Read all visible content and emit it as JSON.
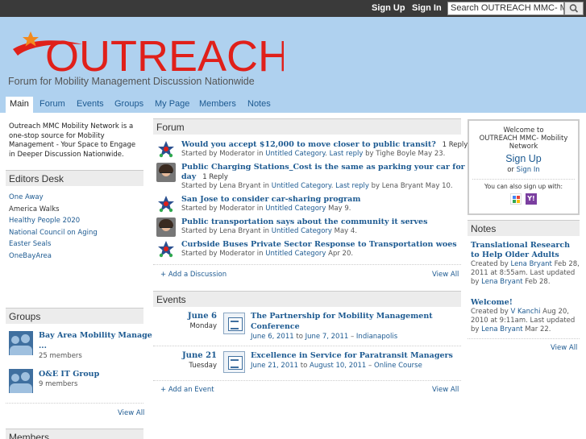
{
  "topbar": {
    "signup": "Sign Up",
    "signin": "Sign In",
    "search_value": "Search OUTREACH MMC- Mobi"
  },
  "header": {
    "logo_text": "OUTREACH",
    "tagline": "Forum for Mobility Management Discussion Nationwide",
    "brand_color": "#e0201a"
  },
  "nav": [
    "Main",
    "Forum",
    "Events",
    "Groups",
    "My Page",
    "Members",
    "Notes"
  ],
  "left": {
    "intro": "Outreach MMC Mobility Network is a one-stop source for Mobility Management - Your Space to Engage in Deeper Discussion Nationwide.",
    "editors_title": "Editors Desk",
    "editors_links": [
      "One Away",
      "America Walks",
      "Healthy People 2020",
      "National Council on Aging",
      "Easter Seals",
      "OneBayArea"
    ],
    "groups_title": "Groups",
    "groups": [
      {
        "name": "Bay Area Mobility Manage",
        "ellipsis": "...",
        "members": "25 members"
      },
      {
        "name": "O&E IT Group",
        "members": "9 members"
      }
    ],
    "groups_view_all": "View All",
    "members_title": "Members"
  },
  "forum": {
    "title": "Forum",
    "items": [
      {
        "title": "Would you accept $12,000 to move closer to public transit?",
        "reply": "1 Reply",
        "started_by": "Started by Moderator in",
        "category": "Untitled Category",
        "last_reply_label": "Last reply",
        "last_reply_by": "by Tighe Boyle May 23."
      },
      {
        "title": "Public Charging Stations_Cost is the same as parking your car for the",
        "title2": "day",
        "reply": "1 Reply",
        "started_by": "Started by Lena Bryant in",
        "category": "Untitled Category",
        "last_reply_label": "Last reply",
        "last_reply_by": "by Lena Bryant May 10."
      },
      {
        "title": "San Jose to consider car-sharing program",
        "started_by": "Started by Moderator in",
        "category": "Untitled Category",
        "date": "May 9."
      },
      {
        "title": "Public transportation says about the community it serves",
        "started_by": "Started by Lena Bryant in",
        "category": "Untitled Category",
        "date": "May 4."
      },
      {
        "title": "Curbside Buses Private Sector Response to Transportation woes",
        "started_by": "Started by Moderator in",
        "category": "Untitled Category",
        "date": "Apr 20."
      }
    ],
    "add": "+ Add a Discussion",
    "view_all": "View All"
  },
  "events": {
    "title": "Events",
    "items": [
      {
        "date": "June 6",
        "weekday": "Monday",
        "title": "The Partnership for Mobility Management",
        "title2": "Conference",
        "start": "June 6, 2011",
        "to": "to",
        "end": "June 7, 2011",
        "sep": "–",
        "location": "Indianapolis"
      },
      {
        "date": "June 21",
        "weekday": "Tuesday",
        "title": "Excellence in Service for Paratransit Managers",
        "start": "June 21, 2011",
        "to": "to",
        "end": "August 10, 2011",
        "sep": "–",
        "location": "Online Course"
      }
    ],
    "add": "+ Add an Event",
    "view_all": "View All"
  },
  "welcome": {
    "line1": "Welcome to",
    "line2": "OUTREACH MMC- Mobility",
    "line3": "Network",
    "signup": "Sign Up",
    "or": "or",
    "signin": "Sign In",
    "also": "You can also sign up with:"
  },
  "notes": {
    "title": "Notes",
    "items": [
      {
        "title": "Translational Research to Help Older Adults",
        "meta1": "Created by",
        "author": "Lena Bryant",
        "meta2": "Feb 28, 2011 at 8:55am. Last updated by",
        "updater": "Lena Bryant",
        "meta3": "Feb 28."
      },
      {
        "title": "Welcome!",
        "meta1": "Created by",
        "author": "V Kanchi",
        "meta2": "Aug 20, 2010 at 9:11am. Last updated by",
        "updater": "Lena Bryant",
        "meta3": "Mar 22."
      }
    ],
    "view_all": "View All"
  }
}
